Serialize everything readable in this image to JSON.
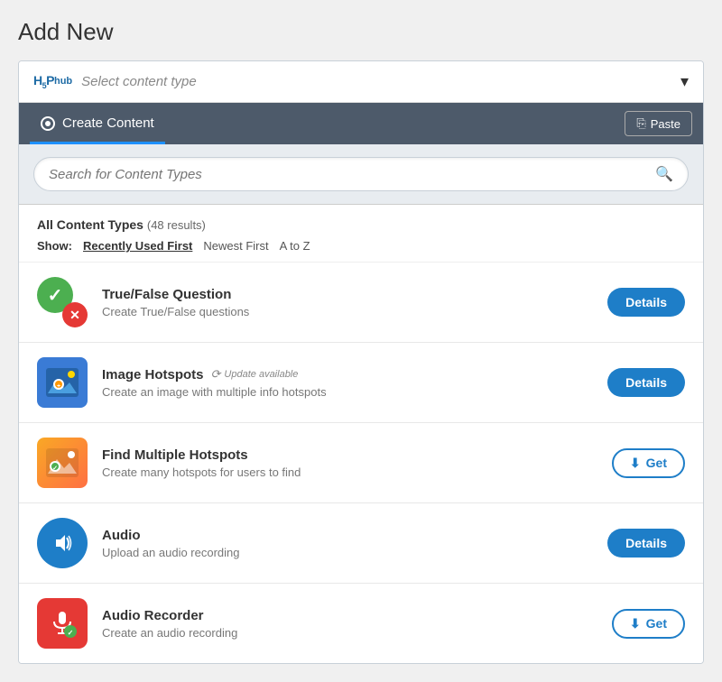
{
  "page": {
    "title": "Add New"
  },
  "selector": {
    "logo": "H₅P",
    "logo_sub": "hub",
    "placeholder": "Select content type",
    "chevron": "▾"
  },
  "header": {
    "tab_label": "Create Content",
    "paste_label": "Paste",
    "paste_icon": "📋"
  },
  "search": {
    "placeholder": "Search for Content Types"
  },
  "filter": {
    "all_label": "All Content Types",
    "results": "(48 results)",
    "show_label": "Show:",
    "sort_options": [
      {
        "label": "Recently Used First",
        "active": true
      },
      {
        "label": "Newest First",
        "active": false
      },
      {
        "label": "A to Z",
        "active": false
      }
    ]
  },
  "items": [
    {
      "id": "true-false",
      "title": "True/False Question",
      "description": "Create True/False questions",
      "action": "Details",
      "action_type": "details",
      "update": false
    },
    {
      "id": "image-hotspots",
      "title": "Image Hotspots",
      "description": "Create an image with multiple info hotspots",
      "action": "Details",
      "action_type": "details",
      "update": true,
      "update_text": "Update available"
    },
    {
      "id": "find-hotspots",
      "title": "Find Multiple Hotspots",
      "description": "Create many hotspots for users to find",
      "action": "Get",
      "action_type": "get",
      "update": false
    },
    {
      "id": "audio",
      "title": "Audio",
      "description": "Upload an audio recording",
      "action": "Details",
      "action_type": "details",
      "update": false
    },
    {
      "id": "audio-recorder",
      "title": "Audio Recorder",
      "description": "Create an audio recording",
      "action": "Get",
      "action_type": "get",
      "update": false
    }
  ],
  "colors": {
    "accent_blue": "#1e7ec8",
    "header_bg": "#4d5a6a",
    "tab_underline": "#1e90ff"
  }
}
